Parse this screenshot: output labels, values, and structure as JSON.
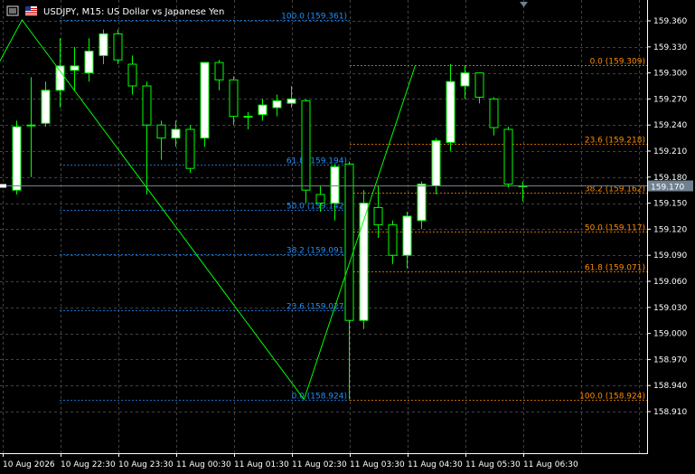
{
  "window": {
    "title": "USDJPY, M15:  US Dollar vs Japanese Yen",
    "icons": [
      "chart-menu-icon",
      "flag-icon"
    ],
    "sort_indicator": "triangle-down-icon"
  },
  "chart_data": {
    "type": "candlestick",
    "symbol": "USDJPY",
    "timeframe": "M15",
    "ylim": [
      158.915,
      159.375
    ],
    "yticks": [
      "159.360",
      "159.330",
      "159.300",
      "159.270",
      "159.240",
      "159.210",
      "159.180",
      "159.150",
      "159.120",
      "159.090",
      "159.060",
      "159.030",
      "159.000",
      "158.970",
      "158.940",
      "158.910"
    ],
    "xticks": [
      "10 Aug 2026",
      "10 Aug 22:30",
      "10 Aug 23:30",
      "11 Aug 00:30",
      "11 Aug 01:30",
      "11 Aug 02:30",
      "11 Aug 03:30",
      "11 Aug 04:30",
      "11 Aug 05:30",
      "11 Aug 06:30"
    ],
    "current_price": "159.170",
    "candles": [
      {
        "o": 159.165,
        "h": 159.245,
        "l": 159.16,
        "c": 159.238
      },
      {
        "o": 159.24,
        "h": 159.295,
        "l": 159.18,
        "c": 159.24
      },
      {
        "o": 159.242,
        "h": 159.29,
        "l": 159.238,
        "c": 159.28
      },
      {
        "o": 159.28,
        "h": 159.34,
        "l": 159.26,
        "c": 159.308
      },
      {
        "o": 159.303,
        "h": 159.33,
        "l": 159.28,
        "c": 159.308
      },
      {
        "o": 159.3,
        "h": 159.34,
        "l": 159.29,
        "c": 159.325
      },
      {
        "o": 159.32,
        "h": 159.35,
        "l": 159.31,
        "c": 159.345
      },
      {
        "o": 159.345,
        "h": 159.35,
        "l": 159.31,
        "c": 159.315
      },
      {
        "o": 159.31,
        "h": 159.32,
        "l": 159.275,
        "c": 159.285
      },
      {
        "o": 159.285,
        "h": 159.29,
        "l": 159.16,
        "c": 159.24
      },
      {
        "o": 159.24,
        "h": 159.245,
        "l": 159.2,
        "c": 159.225
      },
      {
        "o": 159.225,
        "h": 159.245,
        "l": 159.215,
        "c": 159.235
      },
      {
        "o": 159.235,
        "h": 159.24,
        "l": 159.185,
        "c": 159.19
      },
      {
        "o": 159.225,
        "h": 159.295,
        "l": 159.215,
        "c": 159.312
      },
      {
        "o": 159.312,
        "h": 159.315,
        "l": 159.28,
        "c": 159.292
      },
      {
        "o": 159.292,
        "h": 159.296,
        "l": 159.24,
        "c": 159.25
      },
      {
        "o": 159.25,
        "h": 159.255,
        "l": 159.235,
        "c": 159.25
      },
      {
        "o": 159.252,
        "h": 159.27,
        "l": 159.245,
        "c": 159.263
      },
      {
        "o": 159.26,
        "h": 159.275,
        "l": 159.25,
        "c": 159.268
      },
      {
        "o": 159.265,
        "h": 159.285,
        "l": 159.26,
        "c": 159.27
      },
      {
        "o": 159.268,
        "h": 159.27,
        "l": 159.15,
        "c": 159.165
      },
      {
        "o": 159.16,
        "h": 159.17,
        "l": 159.14,
        "c": 159.15
      },
      {
        "o": 159.15,
        "h": 159.195,
        "l": 159.13,
        "c": 159.192
      },
      {
        "o": 159.195,
        "h": 159.198,
        "l": 158.924,
        "c": 159.015
      },
      {
        "o": 159.015,
        "h": 159.165,
        "l": 159.005,
        "c": 159.15
      },
      {
        "o": 159.145,
        "h": 159.17,
        "l": 159.11,
        "c": 159.125
      },
      {
        "o": 159.125,
        "h": 159.13,
        "l": 159.08,
        "c": 159.09
      },
      {
        "o": 159.09,
        "h": 159.14,
        "l": 159.075,
        "c": 159.135
      },
      {
        "o": 159.13,
        "h": 159.175,
        "l": 159.12,
        "c": 159.172
      },
      {
        "o": 159.17,
        "h": 159.225,
        "l": 159.16,
        "c": 159.222
      },
      {
        "o": 159.22,
        "h": 159.31,
        "l": 159.21,
        "c": 159.29
      },
      {
        "o": 159.285,
        "h": 159.309,
        "l": 159.27,
        "c": 159.3
      },
      {
        "o": 159.3,
        "h": 159.3,
        "l": 159.265,
        "c": 159.272
      },
      {
        "o": 159.27,
        "h": 159.272,
        "l": 159.228,
        "c": 159.237
      },
      {
        "o": 159.235,
        "h": 159.238,
        "l": 159.168,
        "c": 159.172
      },
      {
        "o": 159.17,
        "h": 159.175,
        "l": 159.152,
        "c": 159.17
      }
    ],
    "zigzag": [
      {
        "i": -3.5,
        "p": 159.24
      },
      {
        "i": 0.4,
        "p": 159.361
      },
      {
        "i": 19.9,
        "p": 158.924
      },
      {
        "i": 27.6,
        "p": 159.309
      }
    ],
    "fib_left": {
      "from": 159.361,
      "to": 158.924,
      "levels": [
        {
          "pct": "100.0",
          "label": "100.0 (159.361)",
          "price": 159.361
        },
        {
          "pct": "61.8",
          "label": "61.8 (159.194)",
          "price": 159.194
        },
        {
          "pct": "50.0",
          "label": "50.0 (159.142)",
          "price": 159.142
        },
        {
          "pct": "38.2",
          "label": "38.2 (159.091)",
          "price": 159.091
        },
        {
          "pct": "23.6",
          "label": "23.6 (159.027)",
          "price": 159.027
        },
        {
          "pct": "0.0",
          "label": "0.0 (158.924)",
          "price": 158.924
        }
      ]
    },
    "fib_right": {
      "from": 158.924,
      "to": 159.309,
      "levels": [
        {
          "pct": "0.0",
          "label": "0.0 (159.309)",
          "price": 159.309
        },
        {
          "pct": "23.6",
          "label": "23.6 (159.218)",
          "price": 159.218
        },
        {
          "pct": "38.2",
          "label": "38.2 (159.162)",
          "price": 159.162
        },
        {
          "pct": "50.0",
          "label": "50.0 (159.117)",
          "price": 159.117
        },
        {
          "pct": "61.8",
          "label": "61.8 (159.071)",
          "price": 159.071
        },
        {
          "pct": "100.0",
          "label": "100.0 (158.924)",
          "price": 158.924
        }
      ]
    },
    "colors": {
      "background": "#000000",
      "grid": "#414141",
      "bull_body": "#ffffff",
      "bear_body": "#000000",
      "candle_outline": "#00ff00",
      "zigzag": "#00ff00",
      "fib_left": "#1e90ff",
      "fib_left_text": "#1e90ff",
      "fib_right": "#ff8c00",
      "fib_right_text": "#ff8c00",
      "axis_text": "#ffffff",
      "price_line": "#708090"
    },
    "grid": true
  }
}
